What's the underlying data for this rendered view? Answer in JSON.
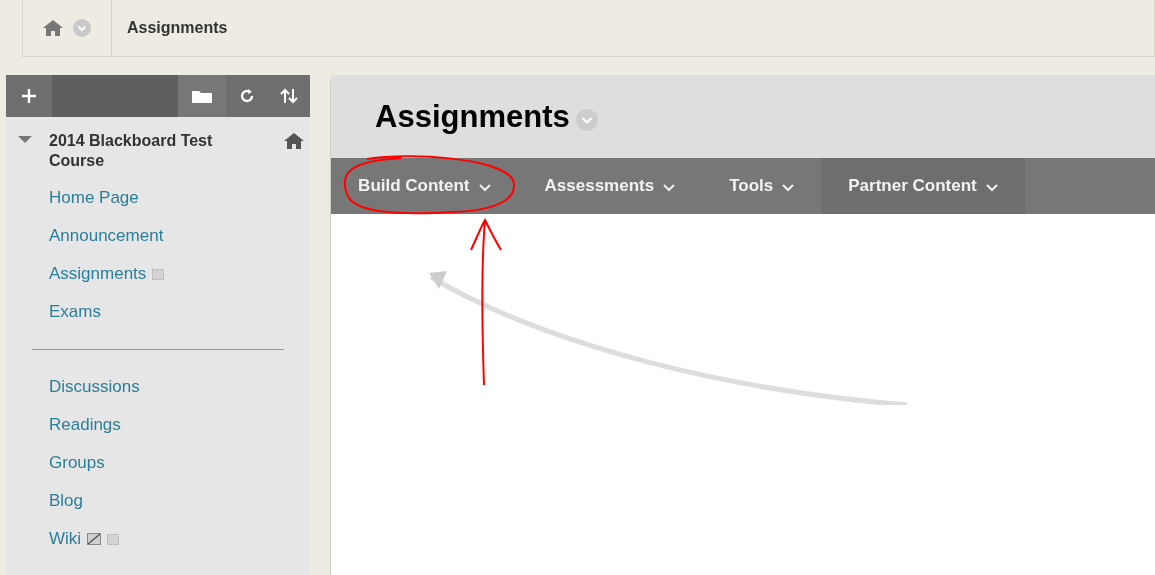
{
  "breadcrumb": {
    "current": "Assignments"
  },
  "sidebar": {
    "course": {
      "title": "2014 Blackboard Test Course",
      "expanded": true
    },
    "groups": [
      [
        {
          "label": "Home Page"
        },
        {
          "label": "Announcement"
        },
        {
          "label": "Assignments",
          "marks": [
            {
              "kind": "square"
            }
          ]
        },
        {
          "label": "Exams"
        }
      ],
      [
        {
          "label": "Discussions"
        },
        {
          "label": "Readings"
        },
        {
          "label": "Groups"
        },
        {
          "label": "Blog"
        },
        {
          "label": "Wiki",
          "marks": [
            {
              "kind": "slash"
            },
            {
              "kind": "square"
            }
          ]
        }
      ]
    ]
  },
  "page": {
    "title": "Assignments",
    "menu": [
      {
        "label": "Build Content",
        "circled": true
      },
      {
        "label": "Assessments",
        "circled": false
      },
      {
        "label": "Tools",
        "circled": false
      },
      {
        "label": "Partner Content",
        "circled": false
      }
    ]
  }
}
